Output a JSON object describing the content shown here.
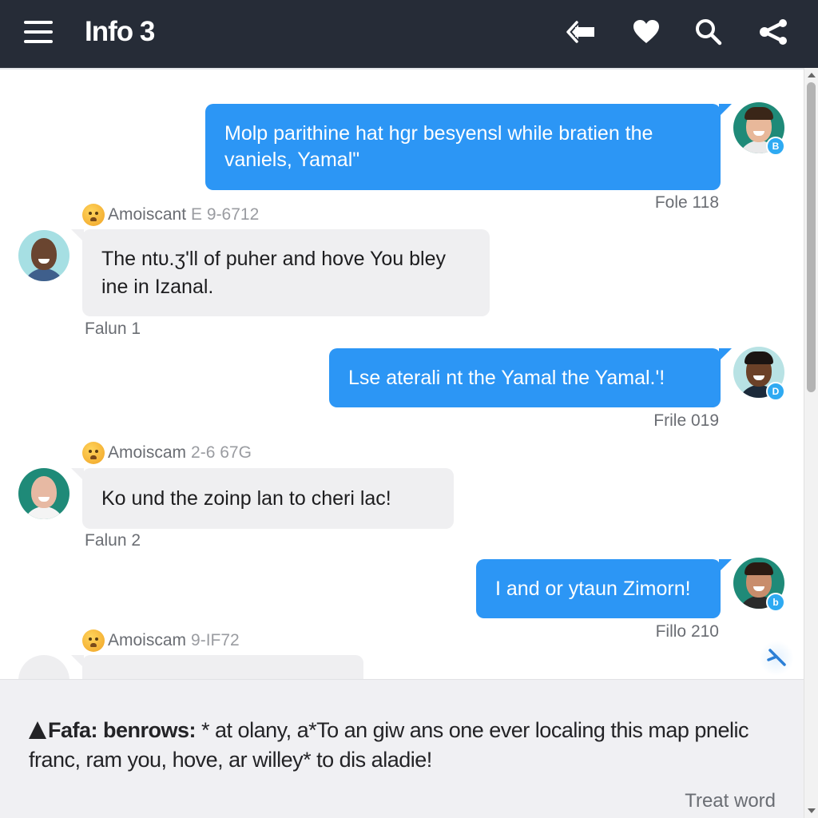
{
  "header": {
    "title": "Info 3",
    "icons": [
      "menu-icon",
      "back-arrow-icon",
      "heart-icon",
      "search-icon",
      "share-icon"
    ]
  },
  "colors": {
    "topbar": "#262c37",
    "outgoing_bubble": "#2c96f5",
    "incoming_bubble": "#efeff1",
    "badge": "#2eaaf2",
    "composer_bg": "#f0f0f3"
  },
  "messages": [
    {
      "direction": "outgoing",
      "text": "Molp parithine hat hgr besyensl while bratien the vaniels, Yamal\"",
      "meta": "Fole 118",
      "badge": "B"
    },
    {
      "direction": "incoming",
      "sender": "Amoiscant",
      "sender_code": "E 9-6712",
      "text": "The ntυ.ʒ'll of puher and hove You bley ine in Izanal.",
      "meta": "Falun 1"
    },
    {
      "direction": "outgoing",
      "text": "Lse aterali nt the Yamal the Yamal.'!",
      "meta": "Frile 019",
      "badge": "D"
    },
    {
      "direction": "incoming",
      "sender": "Amoiscam",
      "sender_code": "2-6 67G",
      "text": "Ko und the zoinp lan to cheri lac!",
      "meta": "Falun 2"
    },
    {
      "direction": "outgoing",
      "text": "I and or ytaun Zimorn!",
      "meta": "Fillo 210",
      "badge": "b"
    },
    {
      "direction": "incoming",
      "sender": "Amoiscam",
      "sender_code": "9-IF72",
      "text": "",
      "meta": "",
      "clipped": true
    }
  ],
  "composer": {
    "label": "Fafa: benrows:",
    "text": " * at olany, a*To an giw ans one ever localing this map pnelic franc, ram you, hove, ar willey* to dis aladie!",
    "action": "Treat word"
  },
  "scroll": {
    "position_fraction": 0.0,
    "visible_fraction": 0.43
  }
}
